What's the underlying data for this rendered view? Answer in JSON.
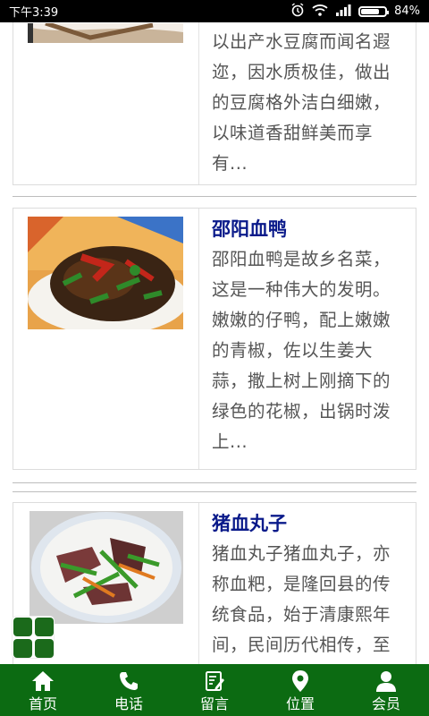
{
  "status_bar": {
    "time": "下午3:39",
    "battery": "84%",
    "battery_level": 0.84
  },
  "articles": [
    {
      "title": "",
      "lines": [
        "以出产水豆腐而闻名遐",
        "迩，因水质极佳，做出",
        "的豆腐格外洁白细嫩，",
        "以味道香甜鲜美而享",
        "有..."
      ]
    },
    {
      "title": "邵阳血鸭",
      "lines": [
        "邵阳血鸭是故乡名菜，",
        "这是一种伟大的发明。",
        "嫩嫩的仔鸭，配上嫩嫩",
        "的青椒，佐以生姜大",
        "蒜，撒上树上刚摘下的",
        "绿色的花椒，出锅时泼",
        "上..."
      ]
    },
    {
      "title": "猪血丸子",
      "lines": [
        "猪血丸子猪血丸子，亦",
        "称血粑，是隆回县的传",
        "统食品，始于清康熙年",
        "间，民间历代相传，至"
      ]
    }
  ],
  "nav": [
    {
      "label": "首页",
      "icon": "home-icon"
    },
    {
      "label": "电话",
      "icon": "phone-icon"
    },
    {
      "label": "留言",
      "icon": "message-edit-icon"
    },
    {
      "label": "位置",
      "icon": "location-pin-icon"
    },
    {
      "label": "会员",
      "icon": "user-icon"
    }
  ],
  "colors": {
    "nav_bg": "#0c6b12",
    "title": "#0a1a8a",
    "text": "#555555"
  }
}
